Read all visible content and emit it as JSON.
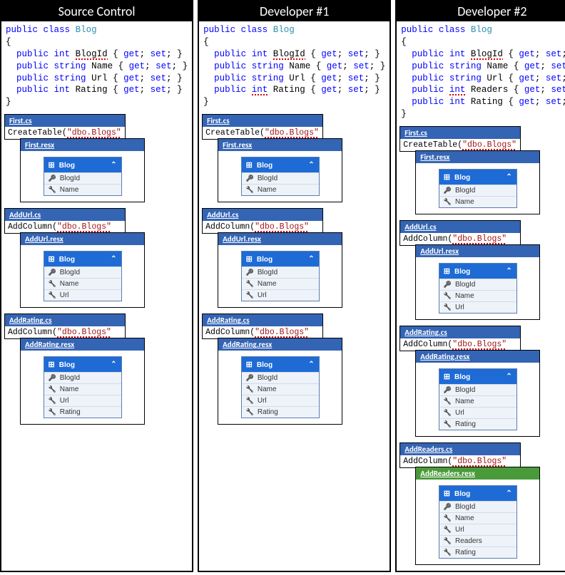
{
  "columns": [
    {
      "title": "Source Control",
      "code": {
        "classDecl": "public class Blog",
        "props": [
          {
            "type": "int",
            "name": "BlogId",
            "underlined": true
          },
          {
            "type": "string",
            "name": "Name"
          },
          {
            "type": "string",
            "name": "Url"
          },
          {
            "type": "int",
            "name": "Rating"
          }
        ]
      },
      "migrations": [
        {
          "cs": "First.cs",
          "body": "CreateTable(\"dbo.Blogs\"",
          "resx": "First.resx",
          "green": false,
          "fields": [
            "BlogId",
            "Name"
          ]
        },
        {
          "cs": "AddUrl.cs",
          "body": "AddColumn(\"dbo.Blogs\"",
          "resx": "AddUrl.resx",
          "green": false,
          "fields": [
            "BlogId",
            "Name",
            "Url"
          ]
        },
        {
          "cs": "AddRating.cs",
          "body": "AddColumn(\"dbo.Blogs\"",
          "resx": "AddRating.resx",
          "green": false,
          "fields": [
            "BlogId",
            "Name",
            "Url",
            "Rating"
          ]
        }
      ]
    },
    {
      "title": "Developer #1",
      "code": {
        "classDecl": "public class Blog",
        "props": [
          {
            "type": "int",
            "name": "BlogId",
            "underlined": true
          },
          {
            "type": "string",
            "name": "Name"
          },
          {
            "type": "string",
            "name": "Url"
          },
          {
            "type": "int",
            "name": "Rating",
            "underlinedType": true
          }
        ]
      },
      "migrations": [
        {
          "cs": "First.cs",
          "body": "CreateTable(\"dbo.Blogs\"",
          "resx": "First.resx",
          "green": false,
          "fields": [
            "BlogId",
            "Name"
          ]
        },
        {
          "cs": "AddUrl.cs",
          "body": "AddColumn(\"dbo.Blogs\"",
          "resx": "AddUrl.resx",
          "green": false,
          "fields": [
            "BlogId",
            "Name",
            "Url"
          ]
        },
        {
          "cs": "AddRating.cs",
          "body": "AddColumn(\"dbo.Blogs\"",
          "resx": "AddRating.resx",
          "green": false,
          "fields": [
            "BlogId",
            "Name",
            "Url",
            "Rating"
          ]
        }
      ]
    },
    {
      "title": "Developer #2",
      "code": {
        "classDecl": "public class Blog",
        "props": [
          {
            "type": "int",
            "name": "BlogId",
            "underlined": true
          },
          {
            "type": "string",
            "name": "Name"
          },
          {
            "type": "string",
            "name": "Url"
          },
          {
            "type": "int",
            "name": "Readers",
            "underlinedType": true
          },
          {
            "type": "int",
            "name": "Rating"
          }
        ]
      },
      "migrations": [
        {
          "cs": "First.cs",
          "body": "CreateTable(\"dbo.Blogs\"",
          "resx": "First.resx",
          "green": false,
          "fields": [
            "BlogId",
            "Name"
          ]
        },
        {
          "cs": "AddUrl.cs",
          "body": "AddColumn(\"dbo.Blogs\"",
          "resx": "AddUrl.resx",
          "green": false,
          "fields": [
            "BlogId",
            "Name",
            "Url"
          ]
        },
        {
          "cs": "AddRating.cs",
          "body": "AddColumn(\"dbo.Blogs\"",
          "resx": "AddRating.resx",
          "green": false,
          "fields": [
            "BlogId",
            "Name",
            "Url",
            "Rating"
          ]
        },
        {
          "cs": "AddReaders.cs",
          "body": "AddColumn(\"dbo.Blogs\"",
          "resx": "AddReaders.resx",
          "green": true,
          "fields": [
            "BlogId",
            "Name",
            "Url",
            "Readers",
            "Rating"
          ]
        }
      ]
    }
  ],
  "schemaTable": "Blog",
  "getSet": "{ get; set; }"
}
